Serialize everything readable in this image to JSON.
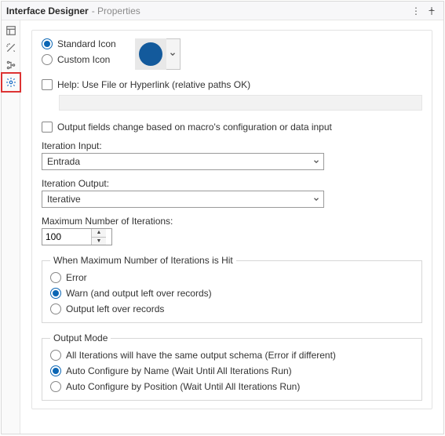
{
  "title": {
    "main": "Interface Designer",
    "sub": "- Properties"
  },
  "iconRadios": {
    "standard": "Standard Icon",
    "custom": "Custom Icon",
    "selected": "standard"
  },
  "iconColor": "#135a9c",
  "help": {
    "label": "Help: Use File or Hyperlink (relative paths OK)",
    "value": ""
  },
  "outputFieldsChange": {
    "label": "Output fields change based on macro's configuration or data input"
  },
  "iterationInput": {
    "label": "Iteration Input:",
    "value": "Entrada"
  },
  "iterationOutput": {
    "label": "Iteration Output:",
    "value": "Iterative"
  },
  "maxIter": {
    "label": "Maximum Number of Iterations:",
    "value": "100"
  },
  "maxHit": {
    "legend": "When Maximum Number of Iterations is Hit",
    "options": {
      "error": "Error",
      "warn": "Warn (and output left over records)",
      "leftover": "Output left over records"
    },
    "selected": "warn"
  },
  "outputMode": {
    "legend": "Output Mode",
    "options": {
      "same": "All Iterations will have the same output schema (Error if different)",
      "byname": "Auto Configure by Name (Wait Until All Iterations Run)",
      "bypos": "Auto Configure by Position (Wait Until All Iterations Run)"
    },
    "selected": "byname"
  }
}
